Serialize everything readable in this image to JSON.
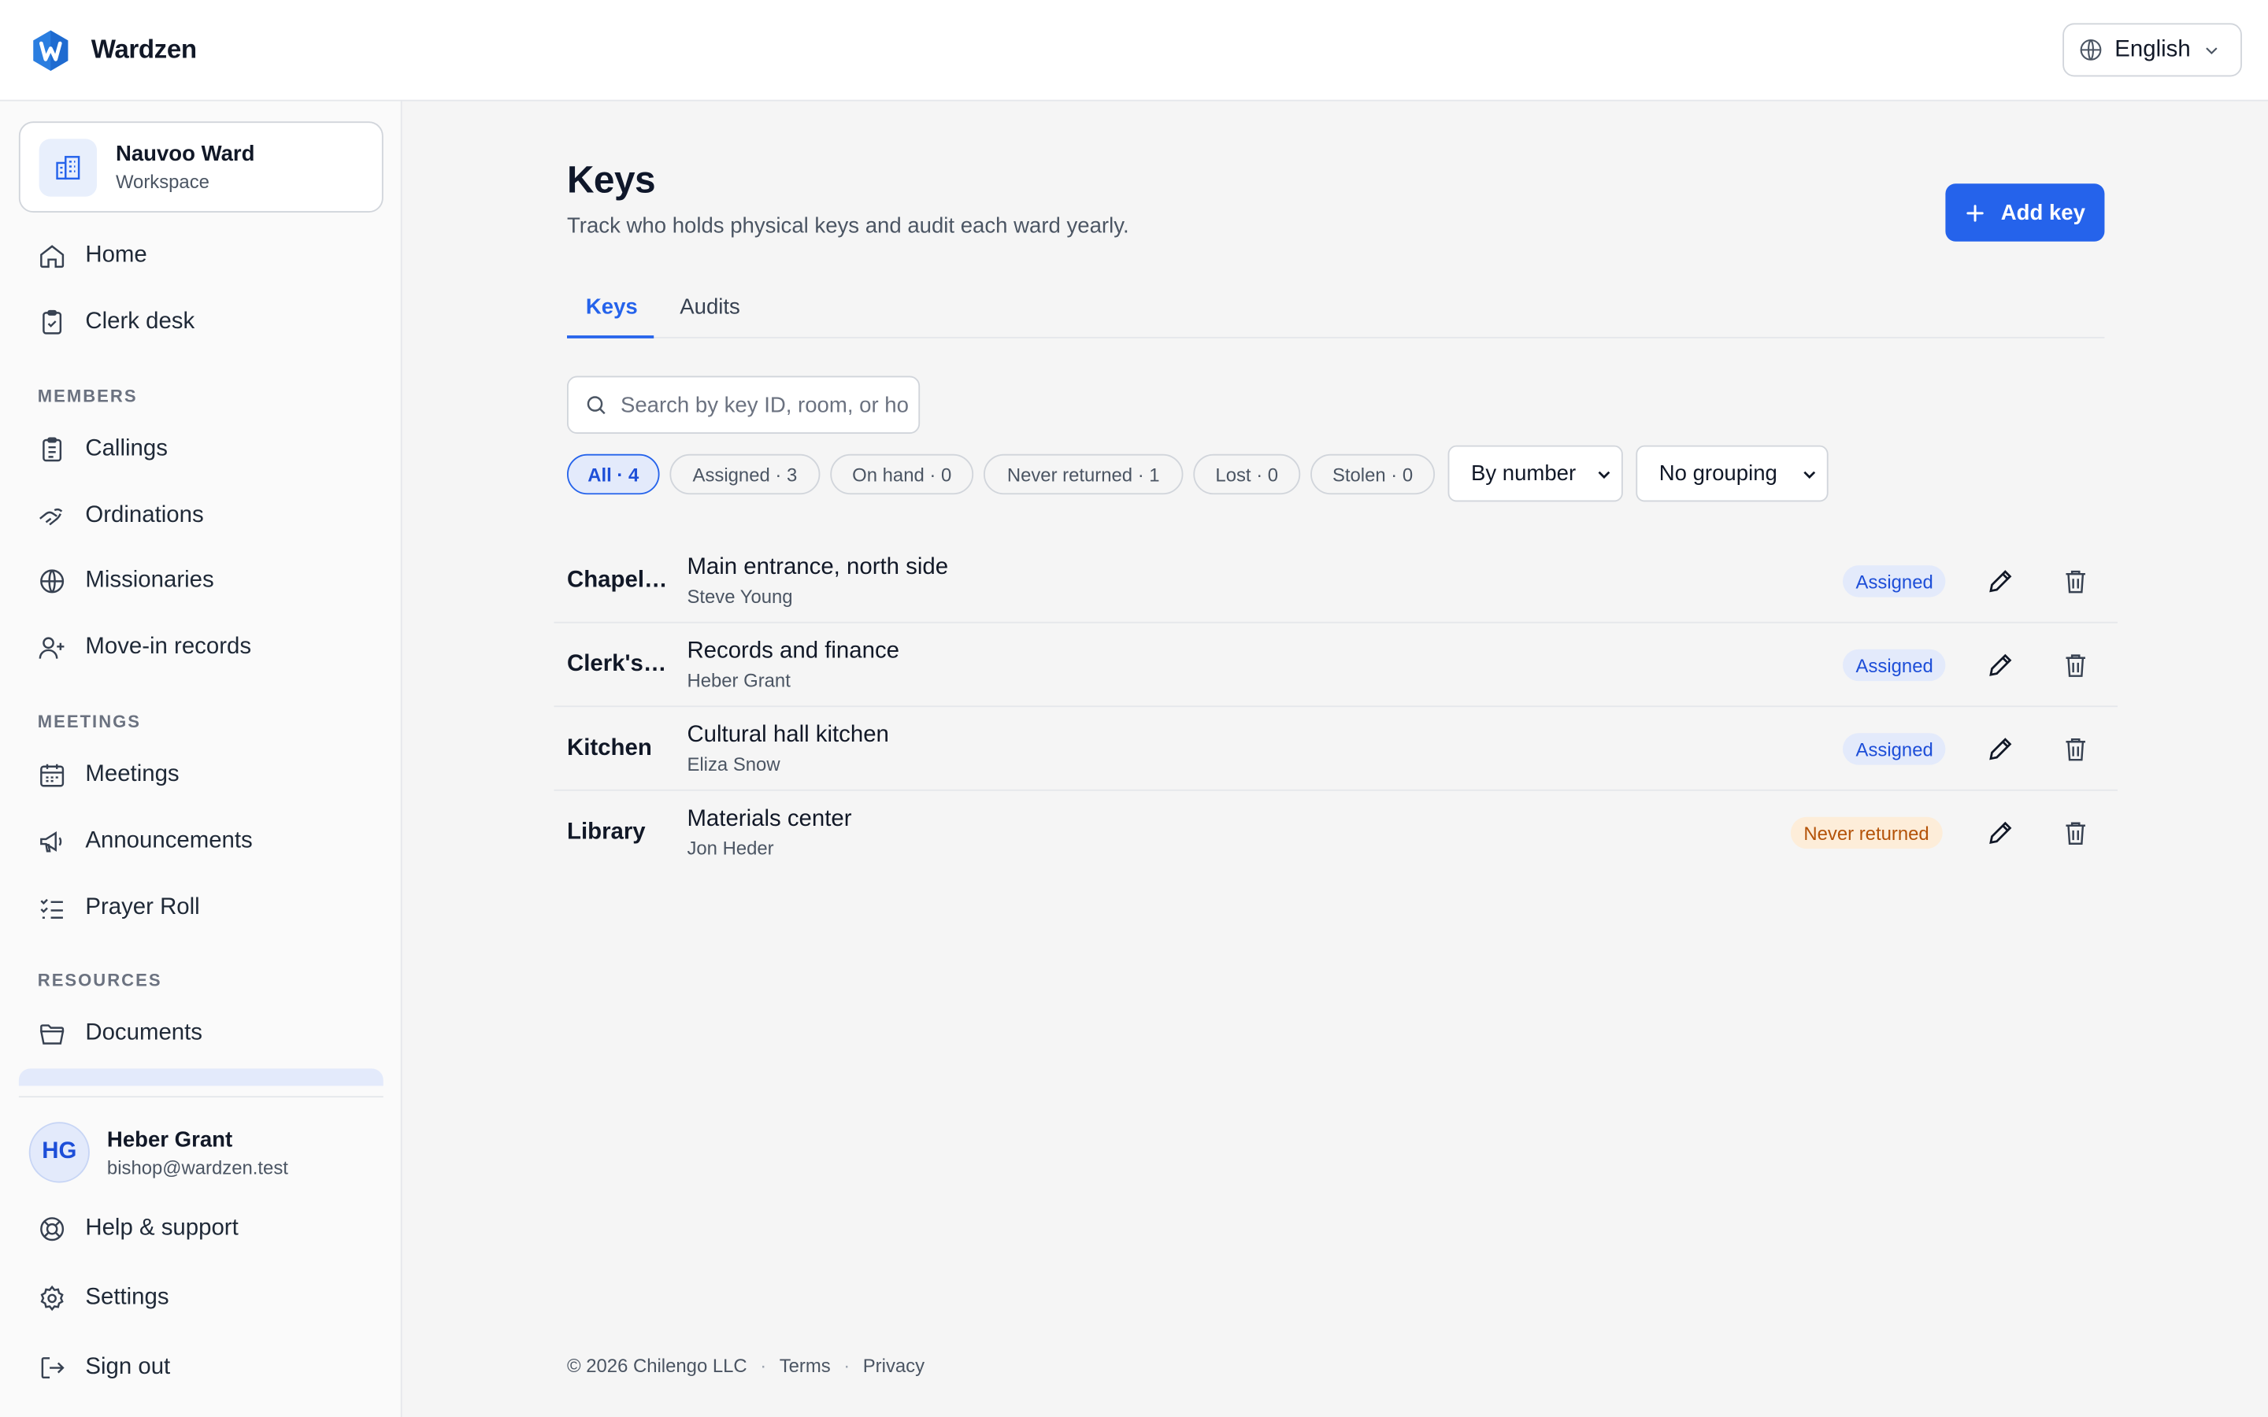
{
  "app": {
    "name": "Wardzen",
    "accent": "#2563eb",
    "language": "English"
  },
  "sidebar": {
    "workspace": {
      "name": "Nauvoo Ward",
      "sub": "Workspace",
      "icon": "building-icon"
    },
    "top_items": [
      {
        "label": "Home",
        "icon": "home-icon"
      },
      {
        "label": "Clerk desk",
        "icon": "clipboard-check-icon"
      }
    ],
    "sections": [
      {
        "title": "MEMBERS",
        "items": [
          {
            "label": "Callings",
            "icon": "clipboard-list-icon"
          },
          {
            "label": "Ordinations",
            "icon": "hands-icon"
          },
          {
            "label": "Missionaries",
            "icon": "globe-icon"
          },
          {
            "label": "Move-in records",
            "icon": "user-plus-icon"
          }
        ]
      },
      {
        "title": "MEETINGS",
        "items": [
          {
            "label": "Meetings",
            "icon": "calendar-icon"
          },
          {
            "label": "Announcements",
            "icon": "megaphone-icon"
          },
          {
            "label": "Prayer Roll",
            "icon": "list-check-icon"
          }
        ]
      },
      {
        "title": "RESOURCES",
        "items": [
          {
            "label": "Documents",
            "icon": "folder-icon"
          }
        ]
      }
    ],
    "user": {
      "initials": "HG",
      "name": "Heber Grant",
      "email": "bishop@wardzen.test"
    },
    "bottom_items": [
      {
        "label": "Help & support",
        "icon": "lifebuoy-icon"
      },
      {
        "label": "Settings",
        "icon": "gear-icon"
      },
      {
        "label": "Sign out",
        "icon": "sign-out-icon"
      }
    ]
  },
  "page": {
    "title": "Keys",
    "subtitle": "Track who holds physical keys and audit each ward yearly.",
    "add_button": "Add key",
    "tabs": [
      {
        "label": "Keys",
        "active": true
      },
      {
        "label": "Audits",
        "active": false
      }
    ],
    "search_placeholder": "Search by key ID, room, or holder",
    "filters": [
      {
        "label": "All · 4",
        "active": true
      },
      {
        "label": "Assigned · 3",
        "active": false
      },
      {
        "label": "On hand · 0",
        "active": false
      },
      {
        "label": "Never returned · 1",
        "active": false
      },
      {
        "label": "Lost · 0",
        "active": false
      },
      {
        "label": "Stolen · 0",
        "active": false
      }
    ],
    "sort_select": "By number",
    "group_select": "No grouping",
    "keys": [
      {
        "id": "Chapel ...",
        "room": "Main entrance, north side",
        "holder": "Steve Young",
        "status": "Assigned",
        "status_kind": "assigned"
      },
      {
        "id": "Clerk's ...",
        "room": "Records and finance",
        "holder": "Heber Grant",
        "status": "Assigned",
        "status_kind": "assigned"
      },
      {
        "id": "Kitchen",
        "room": "Cultural hall kitchen",
        "holder": "Eliza Snow",
        "status": "Assigned",
        "status_kind": "assigned"
      },
      {
        "id": "Library",
        "room": "Materials center",
        "holder": "Jon Heder",
        "status": "Never returned",
        "status_kind": "never"
      }
    ],
    "footer": {
      "copyright": "© 2026 Chilengo LLC",
      "terms": "Terms",
      "privacy": "Privacy"
    }
  }
}
